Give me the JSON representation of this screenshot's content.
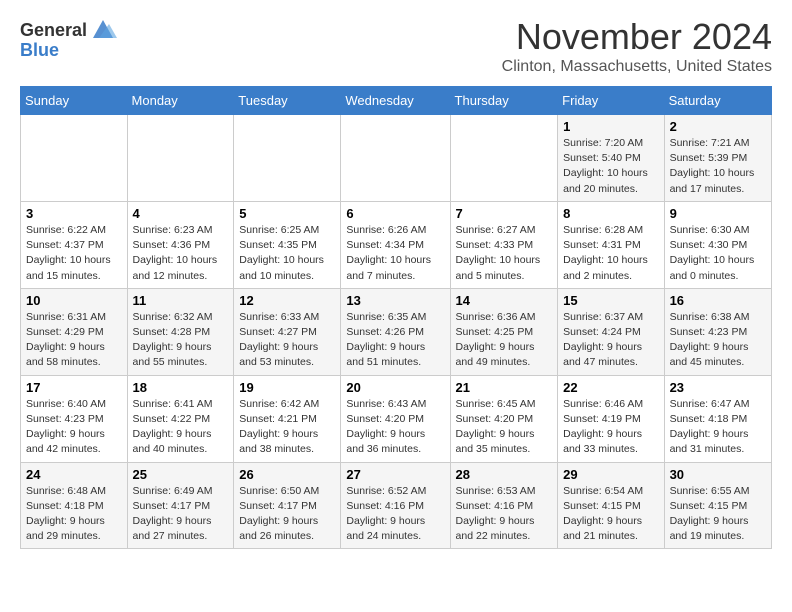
{
  "header": {
    "logo_general": "General",
    "logo_blue": "Blue",
    "month_title": "November 2024",
    "location": "Clinton, Massachusetts, United States"
  },
  "days_of_week": [
    "Sunday",
    "Monday",
    "Tuesday",
    "Wednesday",
    "Thursday",
    "Friday",
    "Saturday"
  ],
  "weeks": [
    [
      {
        "day": "",
        "info": ""
      },
      {
        "day": "",
        "info": ""
      },
      {
        "day": "",
        "info": ""
      },
      {
        "day": "",
        "info": ""
      },
      {
        "day": "",
        "info": ""
      },
      {
        "day": "1",
        "info": "Sunrise: 7:20 AM\nSunset: 5:40 PM\nDaylight: 10 hours and 20 minutes."
      },
      {
        "day": "2",
        "info": "Sunrise: 7:21 AM\nSunset: 5:39 PM\nDaylight: 10 hours and 17 minutes."
      }
    ],
    [
      {
        "day": "3",
        "info": "Sunrise: 6:22 AM\nSunset: 4:37 PM\nDaylight: 10 hours and 15 minutes."
      },
      {
        "day": "4",
        "info": "Sunrise: 6:23 AM\nSunset: 4:36 PM\nDaylight: 10 hours and 12 minutes."
      },
      {
        "day": "5",
        "info": "Sunrise: 6:25 AM\nSunset: 4:35 PM\nDaylight: 10 hours and 10 minutes."
      },
      {
        "day": "6",
        "info": "Sunrise: 6:26 AM\nSunset: 4:34 PM\nDaylight: 10 hours and 7 minutes."
      },
      {
        "day": "7",
        "info": "Sunrise: 6:27 AM\nSunset: 4:33 PM\nDaylight: 10 hours and 5 minutes."
      },
      {
        "day": "8",
        "info": "Sunrise: 6:28 AM\nSunset: 4:31 PM\nDaylight: 10 hours and 2 minutes."
      },
      {
        "day": "9",
        "info": "Sunrise: 6:30 AM\nSunset: 4:30 PM\nDaylight: 10 hours and 0 minutes."
      }
    ],
    [
      {
        "day": "10",
        "info": "Sunrise: 6:31 AM\nSunset: 4:29 PM\nDaylight: 9 hours and 58 minutes."
      },
      {
        "day": "11",
        "info": "Sunrise: 6:32 AM\nSunset: 4:28 PM\nDaylight: 9 hours and 55 minutes."
      },
      {
        "day": "12",
        "info": "Sunrise: 6:33 AM\nSunset: 4:27 PM\nDaylight: 9 hours and 53 minutes."
      },
      {
        "day": "13",
        "info": "Sunrise: 6:35 AM\nSunset: 4:26 PM\nDaylight: 9 hours and 51 minutes."
      },
      {
        "day": "14",
        "info": "Sunrise: 6:36 AM\nSunset: 4:25 PM\nDaylight: 9 hours and 49 minutes."
      },
      {
        "day": "15",
        "info": "Sunrise: 6:37 AM\nSunset: 4:24 PM\nDaylight: 9 hours and 47 minutes."
      },
      {
        "day": "16",
        "info": "Sunrise: 6:38 AM\nSunset: 4:23 PM\nDaylight: 9 hours and 45 minutes."
      }
    ],
    [
      {
        "day": "17",
        "info": "Sunrise: 6:40 AM\nSunset: 4:23 PM\nDaylight: 9 hours and 42 minutes."
      },
      {
        "day": "18",
        "info": "Sunrise: 6:41 AM\nSunset: 4:22 PM\nDaylight: 9 hours and 40 minutes."
      },
      {
        "day": "19",
        "info": "Sunrise: 6:42 AM\nSunset: 4:21 PM\nDaylight: 9 hours and 38 minutes."
      },
      {
        "day": "20",
        "info": "Sunrise: 6:43 AM\nSunset: 4:20 PM\nDaylight: 9 hours and 36 minutes."
      },
      {
        "day": "21",
        "info": "Sunrise: 6:45 AM\nSunset: 4:20 PM\nDaylight: 9 hours and 35 minutes."
      },
      {
        "day": "22",
        "info": "Sunrise: 6:46 AM\nSunset: 4:19 PM\nDaylight: 9 hours and 33 minutes."
      },
      {
        "day": "23",
        "info": "Sunrise: 6:47 AM\nSunset: 4:18 PM\nDaylight: 9 hours and 31 minutes."
      }
    ],
    [
      {
        "day": "24",
        "info": "Sunrise: 6:48 AM\nSunset: 4:18 PM\nDaylight: 9 hours and 29 minutes."
      },
      {
        "day": "25",
        "info": "Sunrise: 6:49 AM\nSunset: 4:17 PM\nDaylight: 9 hours and 27 minutes."
      },
      {
        "day": "26",
        "info": "Sunrise: 6:50 AM\nSunset: 4:17 PM\nDaylight: 9 hours and 26 minutes."
      },
      {
        "day": "27",
        "info": "Sunrise: 6:52 AM\nSunset: 4:16 PM\nDaylight: 9 hours and 24 minutes."
      },
      {
        "day": "28",
        "info": "Sunrise: 6:53 AM\nSunset: 4:16 PM\nDaylight: 9 hours and 22 minutes."
      },
      {
        "day": "29",
        "info": "Sunrise: 6:54 AM\nSunset: 4:15 PM\nDaylight: 9 hours and 21 minutes."
      },
      {
        "day": "30",
        "info": "Sunrise: 6:55 AM\nSunset: 4:15 PM\nDaylight: 9 hours and 19 minutes."
      }
    ]
  ]
}
